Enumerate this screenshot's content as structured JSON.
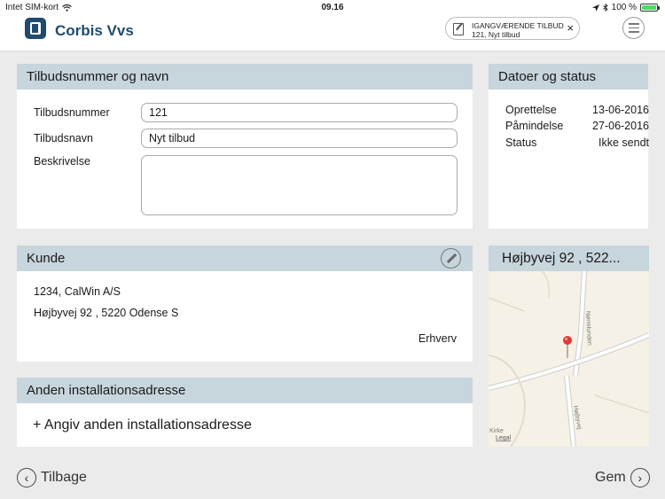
{
  "status_bar": {
    "carrier": "Intet SIM-kort",
    "time": "09.16",
    "battery": "100 %",
    "battery_level": 1.0
  },
  "header": {
    "app_title": "Corbis Vvs",
    "offer_chip": {
      "title": "IGANGVÆRENDE TILBUD",
      "subtitle": "121, Nyt tilbud",
      "close": "×"
    }
  },
  "offer_panel": {
    "title": "Tilbudsnummer og navn",
    "number_label": "Tilbudsnummer",
    "number_value": "121",
    "name_label": "Tilbudsnavn",
    "name_value": "Nyt tilbud",
    "description_label": "Beskrivelse",
    "description_value": ""
  },
  "dates_panel": {
    "title": "Datoer og status",
    "rows": [
      {
        "label": "Oprettelse",
        "value": "13-06-2016"
      },
      {
        "label": "Påmindelse",
        "value": "27-06-2016"
      },
      {
        "label": "Status",
        "value": "Ikke sendt"
      }
    ]
  },
  "customer_panel": {
    "title": "Kunde",
    "line1": "1234, CalWin A/S",
    "line2": "Højbyvej 92 , 5220 Odense S",
    "type": "Erhverv"
  },
  "map_panel": {
    "title": "Højbyvej 92 , 522...",
    "street_label_1": "Nørrelunden",
    "street_label_2": "Højbyvej",
    "place_label": "Kirke",
    "legal": "Legal"
  },
  "install_panel": {
    "title": "Anden installationsadresse",
    "add_label": "+ Angiv anden installationsadresse"
  },
  "nav": {
    "back": "Tilbage",
    "save": "Gem"
  },
  "colors": {
    "header_band": "#c7d5dc",
    "brand": "#1e4b6e",
    "background": "#ebebeb",
    "battery": "#4cd964",
    "pin": "#e53935"
  },
  "icons": [
    "wifi-icon",
    "location-arrow-icon",
    "bluetooth-icon",
    "battery-icon",
    "app-logo-icon",
    "document-edit-icon",
    "close-icon",
    "hamburger-menu-icon",
    "pencil-icon",
    "map-pin-icon",
    "chevron-left-icon",
    "chevron-right-icon"
  ]
}
